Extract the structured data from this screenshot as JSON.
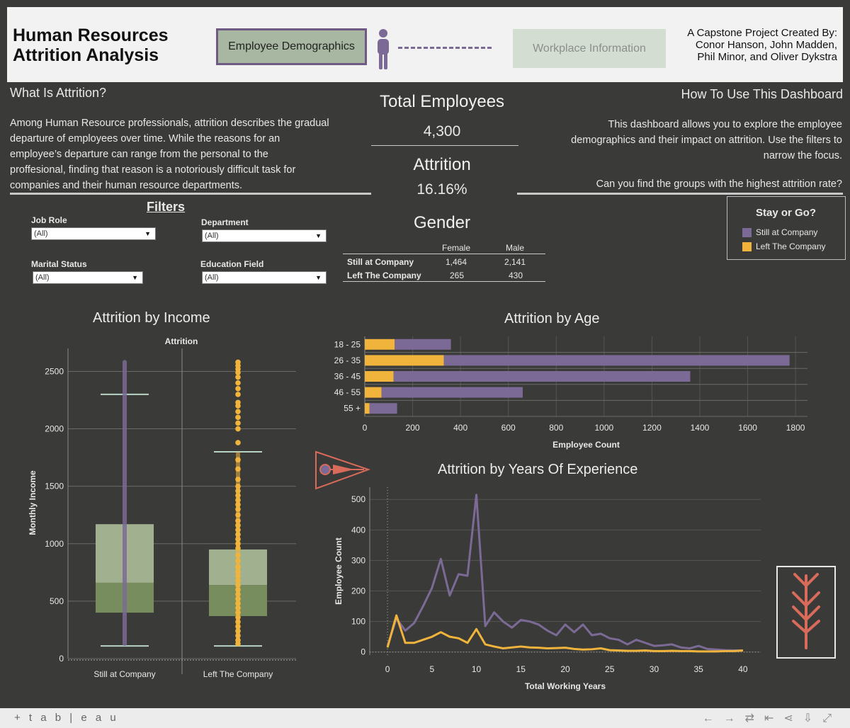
{
  "header": {
    "title_line1": "Human Resources",
    "title_line2": "Attrition Analysis",
    "btn_demographics": "Employee Demographics",
    "btn_workplace": "Workplace Information",
    "credit_line1": "A Capstone Project Created By:",
    "credit_line2": "Conor Hanson, John Madden,",
    "credit_line3": "Phil Minor, and Oliver Dykstra"
  },
  "what": {
    "heading": "What Is Attrition?",
    "line1": "Among Human Resource professionals, attrition describes the gradual",
    "line2": "departure of employees over time.  While the reasons for an",
    "line3": "employee’s departure can range from the personal to the",
    "line4": "proffesional, finding that reason is a notoriously difficult task for",
    "line5": "companies and their human resource departments."
  },
  "howto": {
    "heading": "How To Use This Dashboard",
    "line1": "This dashboard  allows you to explore the employee",
    "line2": "demographics and their impact on attrition. Use the filters to",
    "line3": "narrow the focus.",
    "line4": "Can you find the groups with the highest attrition rate?"
  },
  "kpi": {
    "total_label": "Total Employees",
    "total_value": "4,300",
    "attr_label": "Attrition",
    "attr_value": "16.16%",
    "gender_label": "Gender"
  },
  "filters": {
    "heading": "Filters",
    "job_role_label": "Job Role",
    "job_role_value": "(All)",
    "department_label": "Department",
    "department_value": "(All)",
    "marital_label": "Marital Status",
    "marital_value": "(All)",
    "education_label": "Education Field",
    "education_value": "(All)"
  },
  "gender_table": {
    "col_female": "Female",
    "col_male": "Male",
    "row1_label": "Still at Company",
    "row1_female": "1,464",
    "row1_male": "2,141",
    "row2_label": "Left The Company",
    "row2_female": "265",
    "row2_male": "430"
  },
  "legend": {
    "title": "Stay or Go?",
    "still": "Still at Company",
    "left": "Left The Company"
  },
  "colors": {
    "still": "#7b6a95",
    "left": "#f0b43c",
    "box_light": "#a7b793",
    "box_dark": "#7b9160",
    "accent_red": "#d86b5a"
  },
  "icons": {
    "person": "person-icon",
    "arrow": "arrow-icon",
    "branch": "branch-icon"
  },
  "footer": {
    "logo": "+ t a b | e a u"
  },
  "chart_data": [
    {
      "type": "box",
      "title": "Attrition by Income",
      "header": "Attrition",
      "ylabel": "Monthly Income",
      "ylim": [
        0,
        2700
      ],
      "yticks": [
        0,
        500,
        1000,
        1500,
        2000,
        2500
      ],
      "categories": [
        "Still at Company",
        "Left The Company"
      ],
      "boxes": [
        {
          "name": "Still at Company",
          "lower_whisker": 110,
          "q1": 400,
          "median": 660,
          "q3": 1170,
          "upper_whisker": 2300,
          "max": 2600
        },
        {
          "name": "Left The Company",
          "lower_whisker": 110,
          "q1": 370,
          "median": 640,
          "q3": 950,
          "upper_whisker": 1800,
          "max": 2580
        }
      ]
    },
    {
      "type": "bar",
      "title": "Attrition by Age",
      "orientation": "horizontal",
      "xlabel": "Employee Count",
      "xlim": [
        0,
        1850
      ],
      "xticks": [
        0,
        200,
        400,
        600,
        800,
        1000,
        1200,
        1400,
        1600,
        1800
      ],
      "categories": [
        "18 - 25",
        "26 - 35",
        "36 - 45",
        "46 - 55",
        "55 +"
      ],
      "series": [
        {
          "name": "Left The Company",
          "values": [
            125,
            330,
            120,
            70,
            20
          ]
        },
        {
          "name": "Still at Company",
          "values": [
            235,
            1445,
            1240,
            590,
            115
          ]
        }
      ],
      "stacked": true
    },
    {
      "type": "line",
      "title": "Attrition by Years Of Experience",
      "xlabel": "Total Working Years",
      "ylabel": "Employee Count",
      "xlim": [
        -2,
        42
      ],
      "ylim": [
        -10,
        540
      ],
      "xticks": [
        0,
        5,
        10,
        15,
        20,
        25,
        30,
        35,
        40
      ],
      "yticks": [
        0,
        100,
        200,
        300,
        400,
        500
      ],
      "x": [
        0,
        1,
        2,
        3,
        4,
        5,
        6,
        7,
        8,
        9,
        10,
        11,
        12,
        13,
        14,
        15,
        16,
        17,
        18,
        19,
        20,
        21,
        22,
        23,
        24,
        25,
        26,
        27,
        28,
        29,
        30,
        31,
        32,
        33,
        34,
        35,
        36,
        37,
        38,
        39,
        40
      ],
      "series": [
        {
          "name": "Still at Company",
          "values": [
            20,
            110,
            70,
            95,
            150,
            210,
            305,
            185,
            255,
            250,
            515,
            85,
            130,
            100,
            80,
            105,
            100,
            90,
            70,
            55,
            90,
            65,
            90,
            55,
            60,
            45,
            40,
            25,
            40,
            30,
            20,
            22,
            25,
            15,
            12,
            20,
            10,
            8,
            6,
            5,
            5
          ]
        },
        {
          "name": "Left The Company",
          "values": [
            15,
            120,
            30,
            30,
            40,
            50,
            65,
            50,
            45,
            30,
            75,
            25,
            18,
            12,
            15,
            18,
            15,
            14,
            12,
            13,
            14,
            10,
            8,
            9,
            12,
            6,
            5,
            4,
            4,
            5,
            3,
            3,
            4,
            3,
            3,
            2,
            2,
            2,
            3,
            3,
            5
          ]
        }
      ]
    }
  ]
}
